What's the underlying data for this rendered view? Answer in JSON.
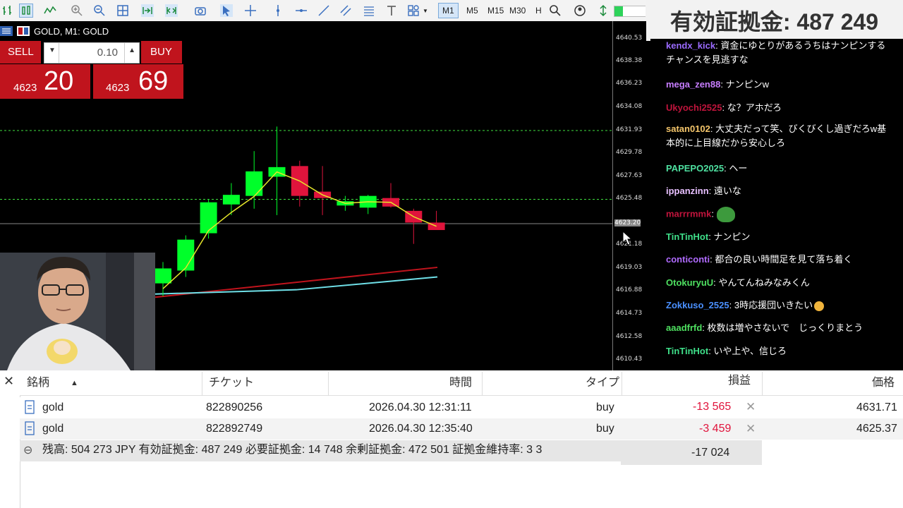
{
  "toolbar": {
    "timeframes": [
      "M1",
      "M5",
      "M15",
      "M30",
      "H"
    ],
    "active_timeframe": "M1"
  },
  "chart": {
    "title": "GOLD, M1:  GOLD",
    "price_ticks": [
      "4640.53",
      "4638.38",
      "4636.23",
      "4634.08",
      "4631.93",
      "4629.78",
      "4627.63",
      "4625.48",
      "4623.20",
      "4621.18",
      "4619.03",
      "4616.88",
      "4614.73",
      "4612.58",
      "4610.43"
    ],
    "current_price_label": "4623.20",
    "candles": [
      {
        "o": 4617.6,
        "h": 4619.6,
        "l": 4616.4,
        "c": 4619.0
      },
      {
        "o": 4618.8,
        "h": 4622.1,
        "l": 4618.2,
        "c": 4621.7
      },
      {
        "o": 4622.3,
        "h": 4625.5,
        "l": 4621.8,
        "c": 4625.2
      },
      {
        "o": 4625.0,
        "h": 4627.0,
        "l": 4624.0,
        "c": 4625.9
      },
      {
        "o": 4625.8,
        "h": 4630.0,
        "l": 4624.6,
        "c": 4628.1
      },
      {
        "o": 4627.6,
        "h": 4632.3,
        "l": 4624.0,
        "c": 4628.5
      },
      {
        "o": 4628.6,
        "h": 4629.1,
        "l": 4624.8,
        "c": 4625.8
      },
      {
        "o": 4626.2,
        "h": 4628.6,
        "l": 4624.0,
        "c": 4625.6
      },
      {
        "o": 4624.9,
        "h": 4625.8,
        "l": 4624.4,
        "c": 4625.3
      },
      {
        "o": 4624.7,
        "h": 4625.9,
        "l": 4624.1,
        "c": 4625.8
      },
      {
        "o": 4625.6,
        "h": 4627.0,
        "l": 4624.7,
        "c": 4624.8
      },
      {
        "o": 4624.4,
        "h": 4624.6,
        "l": 4621.3,
        "c": 4623.3
      },
      {
        "o": 4623.3,
        "h": 4624.4,
        "l": 4623.0,
        "c": 4622.6
      }
    ]
  },
  "oneclick": {
    "sell_label": "SELL",
    "buy_label": "BUY",
    "lot": "0.10",
    "sell_price_small": "4623",
    "sell_price_big": "20",
    "buy_price_small": "4623",
    "buy_price_big": "69"
  },
  "equity_banner": "有効証拠金: 487 249",
  "chat": [
    {
      "user": "kendx_kick",
      "text": "資金にゆとりがあるうちはナンピンするチャンスを見逃すな",
      "color": "#9b6bff"
    },
    {
      "user": "mega_zen88",
      "text": "ナンピンw",
      "color": "#c77dff"
    },
    {
      "user": "Ukyochi2525",
      "text": "な？アホだろ",
      "color": "#c0143c"
    },
    {
      "user": "satan0102",
      "text": "大丈夫だって笑、びくびくし過ぎだろw基本的に上目線だから安心しろ",
      "color": "#f5c66b"
    },
    {
      "user": "PAPEPO2025",
      "text": "ヘー",
      "color": "#4ee0a0"
    },
    {
      "user": "ippanzinn",
      "text": "遠いな",
      "color": "#e8c0ff"
    },
    {
      "user": "marrrmmk",
      "text": "",
      "color": "#c0143c"
    },
    {
      "user": "TinTinHot",
      "text": "ナンピン",
      "color": "#3fe08a"
    },
    {
      "user": "conticonti",
      "text": "都合の良い時間足を見て落ち着く",
      "color": "#b06bff"
    },
    {
      "user": "OtokuryuU",
      "text": "やんてんねみなみくん",
      "color": "#4ee060"
    },
    {
      "user": "Zokkuso_2525",
      "text": "3時応援団いきたい",
      "color": "#4a90ff"
    },
    {
      "user": "aaadfrfd",
      "text": "枚数は増やさないで　じっくりまとう",
      "color": "#4ee060"
    },
    {
      "user": "TinTinHot",
      "text": "いや上や、信じろ",
      "color": "#3fe08a"
    }
  ],
  "positions": {
    "headers": {
      "symbol": "銘柄",
      "ticket": "チケット",
      "time": "時間",
      "type": "タイプ",
      "profit": "損益",
      "price": "価格"
    },
    "rows": [
      {
        "symbol": "gold",
        "ticket": "822890256",
        "time": "2026.04.30 12:31:11",
        "type": "buy",
        "profit": "-13 565",
        "price": "4631.71"
      },
      {
        "symbol": "gold",
        "ticket": "822892749",
        "time": "2026.04.30 12:35:40",
        "type": "buy",
        "profit": "-3 459",
        "price": "4625.37"
      }
    ],
    "summary": "残高: 504 273 JPY  有効証拠金: 487 249  必要証拠金: 14 748  余剰証拠金: 472 501  証拠金維持率: 3 3",
    "total_profit": "-17 024"
  },
  "colors": {
    "bull": "#00ff2a",
    "bear": "#e0143c",
    "ma_fast": "#e6e62a",
    "ma_red": "#c0141d",
    "ma_cyan": "#6fe0e8",
    "loss": "#e0143c"
  }
}
